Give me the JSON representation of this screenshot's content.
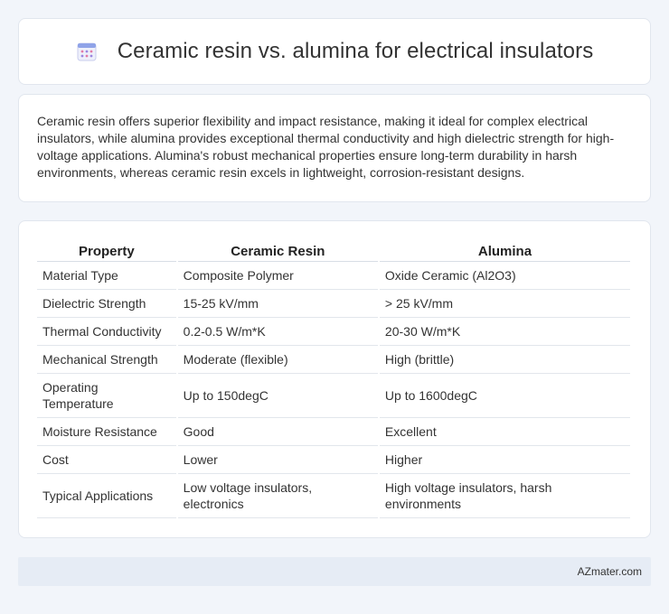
{
  "header": {
    "title": "Ceramic resin vs. alumina for electrical insulators",
    "icon": "calendar-icon"
  },
  "summary": {
    "text": "Ceramic resin offers superior flexibility and impact resistance, making it ideal for complex electrical insulators, while alumina provides exceptional thermal conductivity and high dielectric strength for high-voltage applications. Alumina's robust mechanical properties ensure long-term durability in harsh environments, whereas ceramic resin excels in lightweight, corrosion-resistant designs."
  },
  "table": {
    "headers": [
      "Property",
      "Ceramic Resin",
      "Alumina"
    ],
    "rows": [
      [
        "Material Type",
        "Composite Polymer",
        "Oxide Ceramic (Al2O3)"
      ],
      [
        "Dielectric Strength",
        "15-25 kV/mm",
        "> 25 kV/mm"
      ],
      [
        "Thermal Conductivity",
        "0.2-0.5 W/m*K",
        "20-30 W/m*K"
      ],
      [
        "Mechanical Strength",
        "Moderate (flexible)",
        "High (brittle)"
      ],
      [
        "Operating Temperature",
        "Up to 150degC",
        "Up to 1600degC"
      ],
      [
        "Moisture Resistance",
        "Good",
        "Excellent"
      ],
      [
        "Cost",
        "Lower",
        "Higher"
      ],
      [
        "Typical Applications",
        "Low voltage insulators, electronics",
        "High voltage insulators, harsh environments"
      ]
    ]
  },
  "footer": {
    "brand": "AZmater.com"
  }
}
